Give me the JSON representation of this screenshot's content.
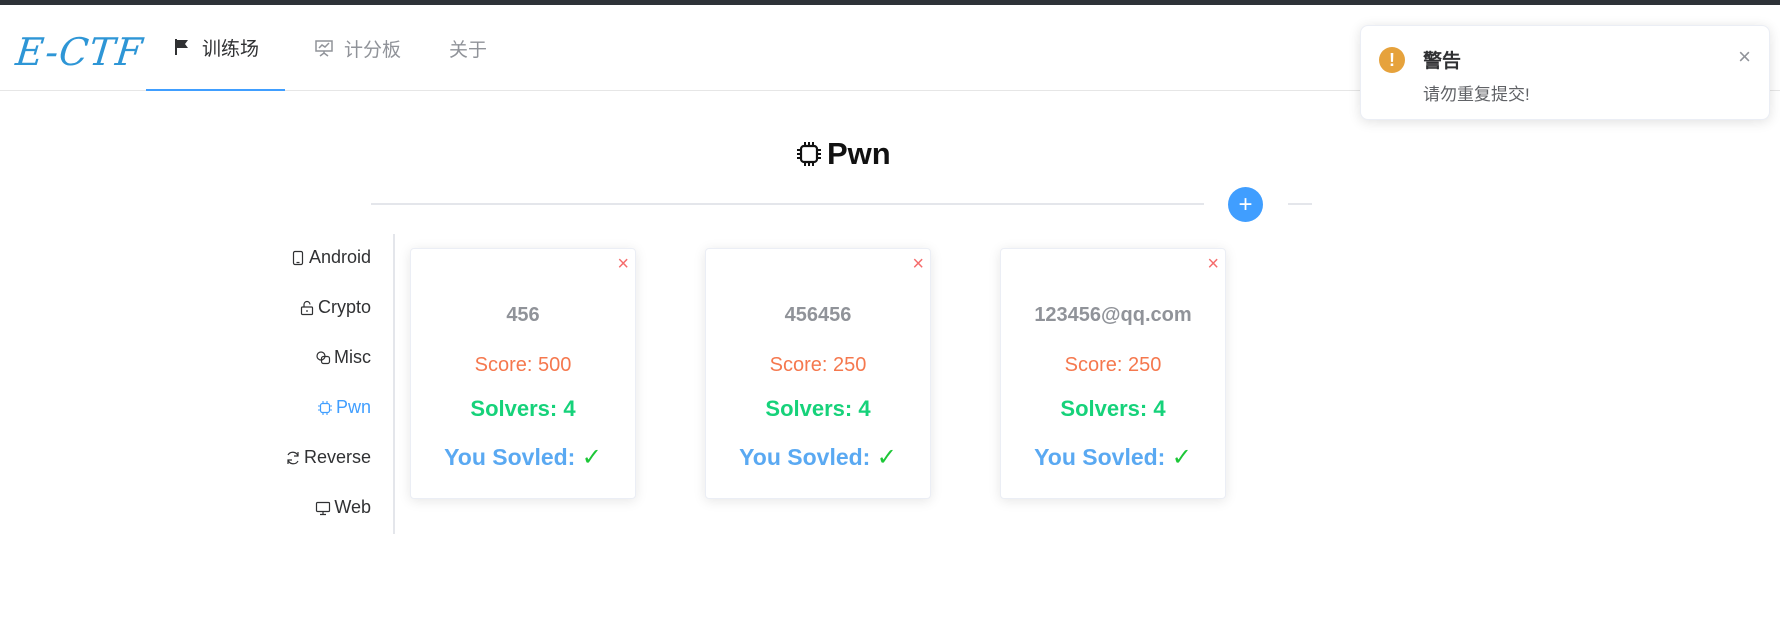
{
  "brand": {
    "logo": "E-CTF"
  },
  "nav": {
    "training": "训练场",
    "scoreboard": "计分板",
    "about": "关于"
  },
  "section": {
    "title": "Pwn",
    "add_label": "+"
  },
  "categories": [
    {
      "label": "Android",
      "icon": "phone-icon"
    },
    {
      "label": "Crypto",
      "icon": "lock-icon"
    },
    {
      "label": "Misc",
      "icon": "link-icon"
    },
    {
      "label": "Pwn",
      "icon": "cpu-icon",
      "active": true
    },
    {
      "label": "Reverse",
      "icon": "refresh-icon"
    },
    {
      "label": "Web",
      "icon": "monitor-icon"
    }
  ],
  "cards": [
    {
      "name": "456",
      "score": "Score: 500",
      "solvers": "Solvers: 4",
      "solved": "You Sovled:",
      "check": "✓",
      "close": "×"
    },
    {
      "name": "456456",
      "score": "Score: 250",
      "solvers": "Solvers: 4",
      "solved": "You Sovled:",
      "check": "✓",
      "close": "×"
    },
    {
      "name": "123456@qq.com",
      "score": "Score: 250",
      "solvers": "Solvers: 4",
      "solved": "You Sovled:",
      "check": "✓",
      "close": "×"
    }
  ],
  "notification": {
    "type": "warning",
    "icon_char": "!",
    "title": "警告",
    "message": "请勿重复提交!",
    "close": "×"
  },
  "colors": {
    "accent": "#409eff",
    "warning": "#e6a23c",
    "score": "#f5784e",
    "solvers": "#16d27a",
    "solved": "#5aa9f2",
    "check": "#1dc738",
    "delete": "#f56c6c"
  }
}
